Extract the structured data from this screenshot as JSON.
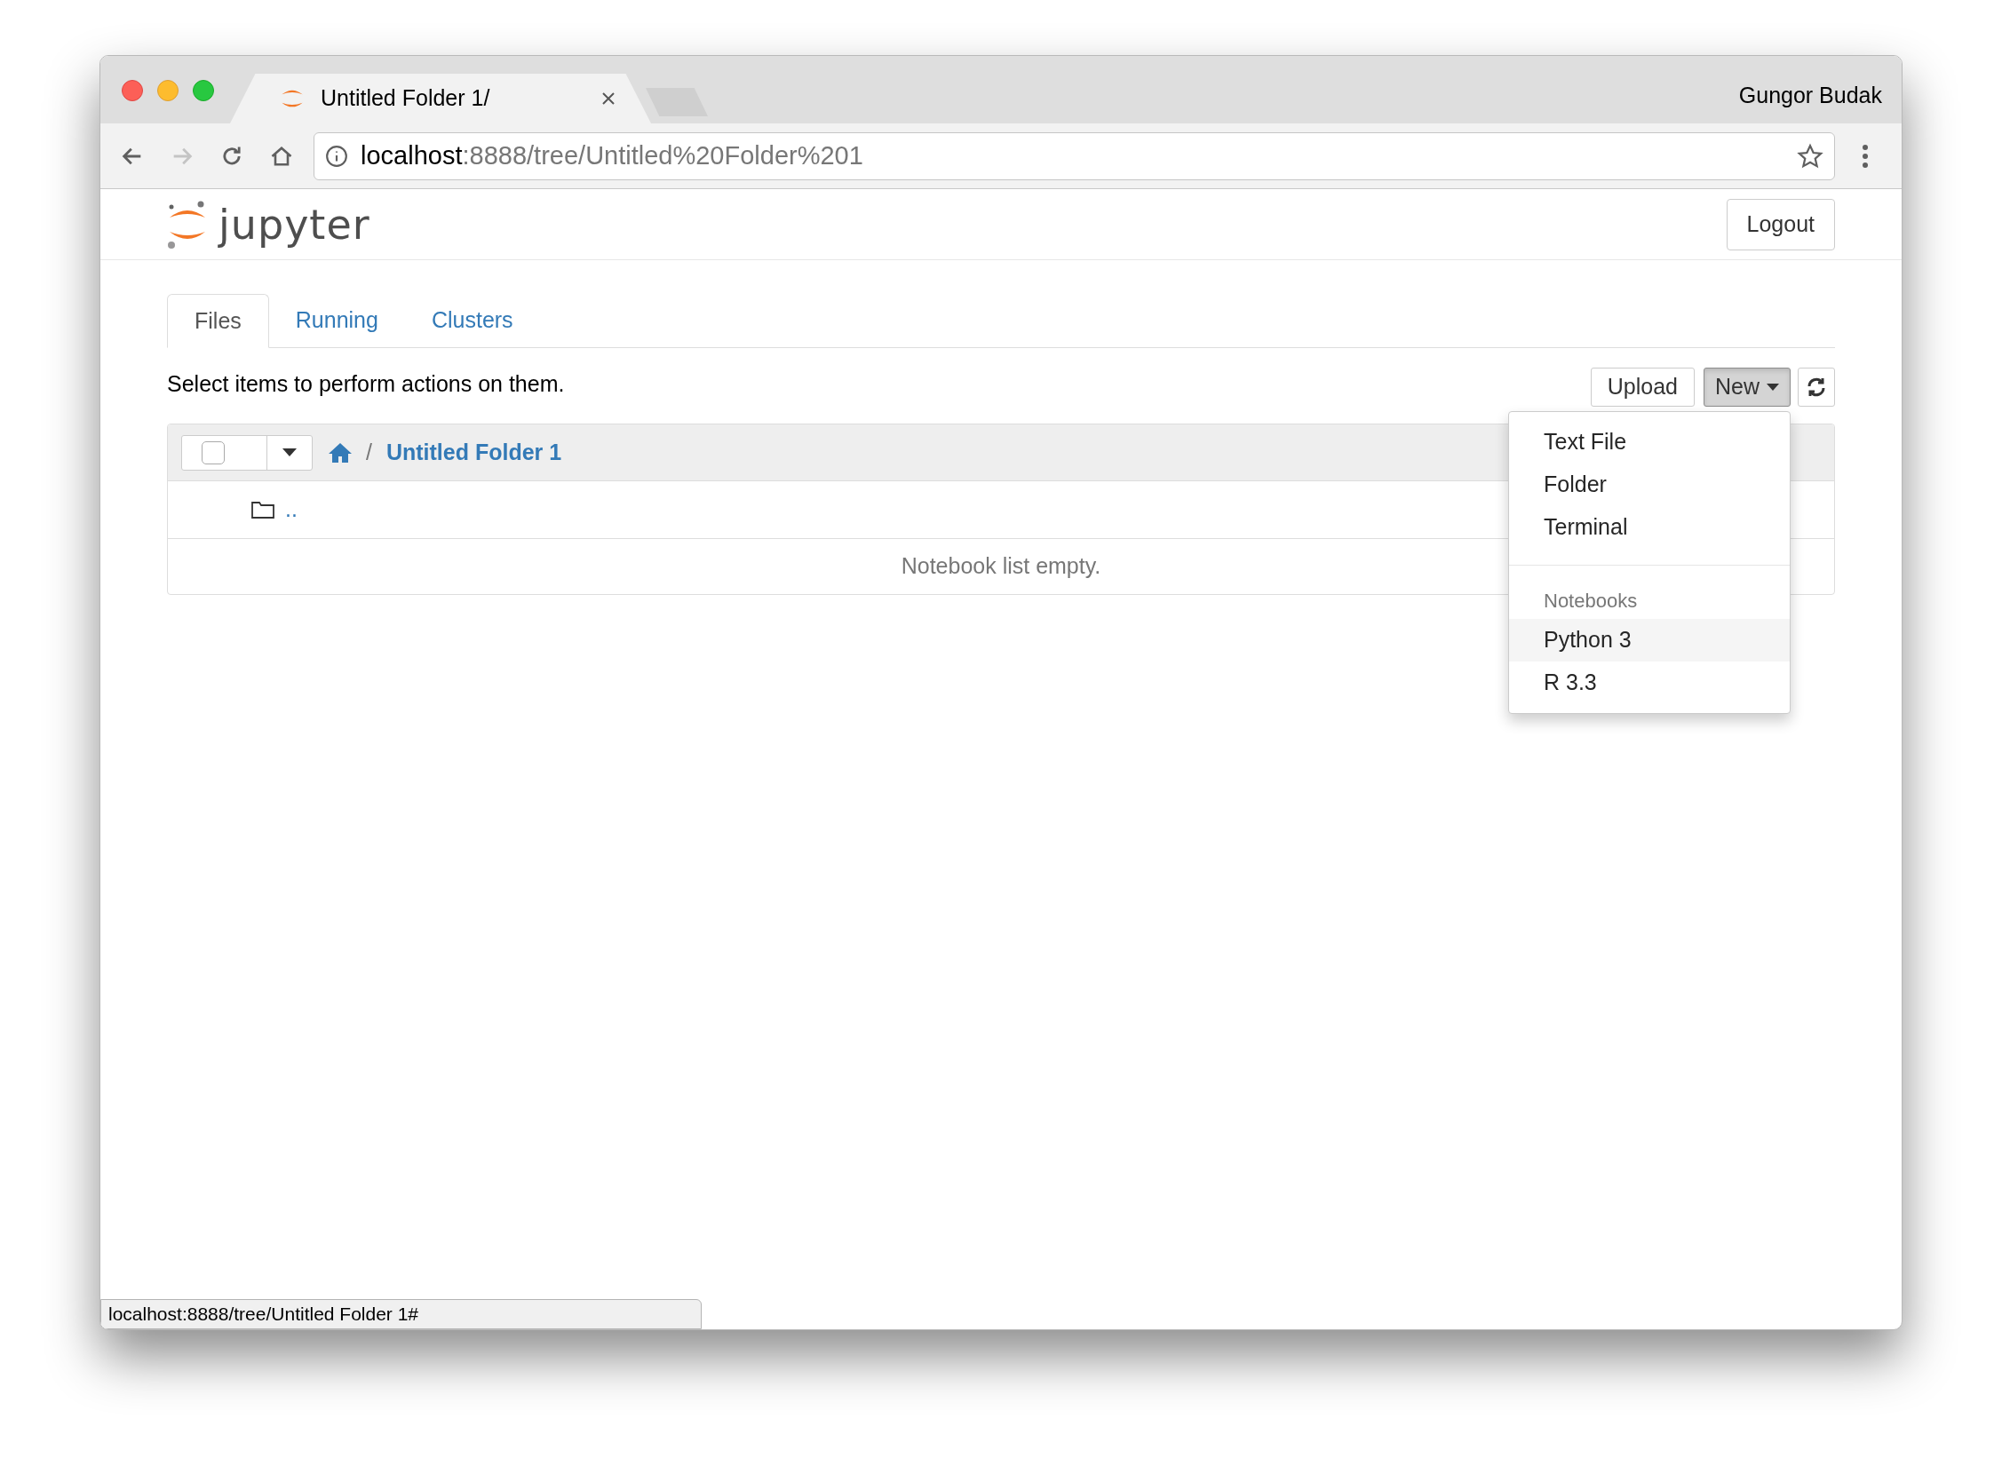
{
  "browser": {
    "tabs": [
      {
        "title": "Untitled Folder 1/",
        "selected": true
      }
    ],
    "user": "Gungor Budak",
    "nav": {
      "back_disabled": false,
      "forward_disabled": true
    },
    "address": {
      "host": "localhost",
      "path": ":8888/tree/Untitled%20Folder%201"
    },
    "status_url": "localhost:8888/tree/Untitled Folder 1#"
  },
  "header": {
    "logo_text": "jupyter",
    "logout": "Logout"
  },
  "tabs": [
    {
      "label": "Files",
      "selected": true
    },
    {
      "label": "Running",
      "selected": false
    },
    {
      "label": "Clusters",
      "selected": false
    }
  ],
  "toolbar": {
    "instruction": "Select items to perform actions on them.",
    "upload": "Upload",
    "new": {
      "label": "New",
      "expanded": true
    }
  },
  "file_list": {
    "select_all_checked": false,
    "breadcrumb_separator": "/",
    "breadcrumb": [
      "Untitled Folder 1"
    ],
    "rows": [
      {
        "name": ".."
      }
    ],
    "empty_message": "Notebook list empty."
  },
  "new_menu": [
    {
      "kind": "item",
      "label": "Text File",
      "highlighted": false
    },
    {
      "kind": "item",
      "label": "Folder",
      "highlighted": false
    },
    {
      "kind": "item",
      "label": "Terminal",
      "highlighted": false
    },
    {
      "kind": "divider"
    },
    {
      "kind": "header",
      "label": "Notebooks"
    },
    {
      "kind": "item",
      "label": "Python 3",
      "highlighted": true
    },
    {
      "kind": "item",
      "label": "R 3.3",
      "highlighted": false
    }
  ]
}
